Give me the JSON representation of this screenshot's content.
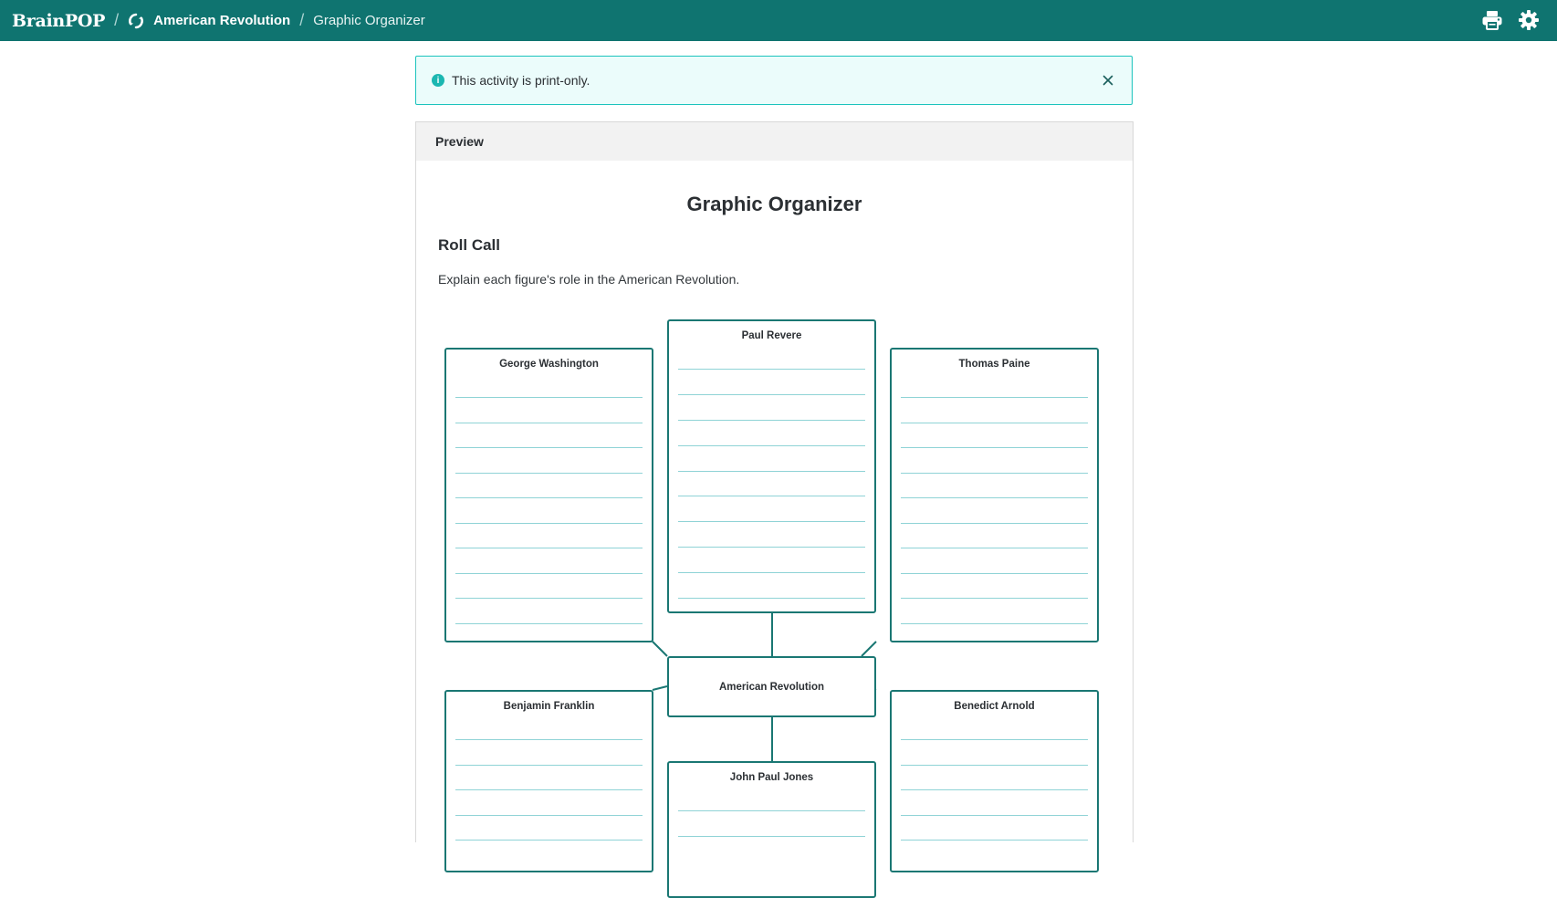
{
  "header": {
    "brand": "BrainPOP",
    "separator": "/",
    "topic": "American Revolution",
    "page": "Graphic Organizer",
    "actions": [
      {
        "name": "print",
        "icon": "printer-icon"
      },
      {
        "name": "settings",
        "icon": "gear-icon"
      }
    ],
    "bar_color": "#0f7470"
  },
  "notice": {
    "text": "This activity is print-only.",
    "icon": "info-icon",
    "info_glyph": "i",
    "close_icon": "close-icon",
    "accent": "#1bc3bd"
  },
  "preview": {
    "label": "Preview",
    "doc_title": "Graphic Organizer",
    "section_title": "Roll Call",
    "instructions": "Explain each figure's role in the American Revolution.",
    "organizer": {
      "center": "American Revolution",
      "figures": [
        "Paul Revere",
        "George Washington",
        "Thomas Paine",
        "Benjamin Franklin",
        "Benedict Arnold",
        "John Paul Jones"
      ],
      "box_color": "#1a7773",
      "line_color": "#8fd3d6"
    }
  }
}
